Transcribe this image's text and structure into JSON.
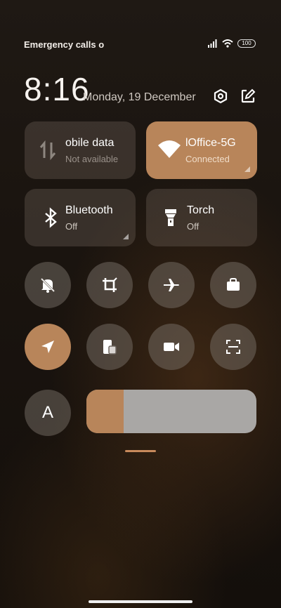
{
  "status_bar": {
    "carrier_text": "Emergency calls o",
    "battery": "100"
  },
  "header": {
    "time": "8:16",
    "date": "Monday, 19 December"
  },
  "tiles": {
    "mobile_data": {
      "title": "obile data",
      "status": "Not available"
    },
    "wifi": {
      "title": "lOffice-5G",
      "status": "Connected",
      "active": true
    },
    "bluetooth": {
      "title": "Bluetooth",
      "status": "Off"
    },
    "torch": {
      "title": "Torch",
      "status": "Off"
    }
  },
  "toggles_row1": [
    "mute-icon",
    "screenshot-crop-icon",
    "airplane-icon",
    "briefcase-icon"
  ],
  "toggles_row2": [
    "location-icon",
    "multitask-icon",
    "video-camera-icon",
    "scanner-icon"
  ],
  "auto_brightness_label": "A",
  "brightness_level": 0.22,
  "colors": {
    "accent": "#b8855a",
    "tile_bg": "#4a423b",
    "round_bg": "#6f6760",
    "slider_bg": "#a9a7a5"
  }
}
